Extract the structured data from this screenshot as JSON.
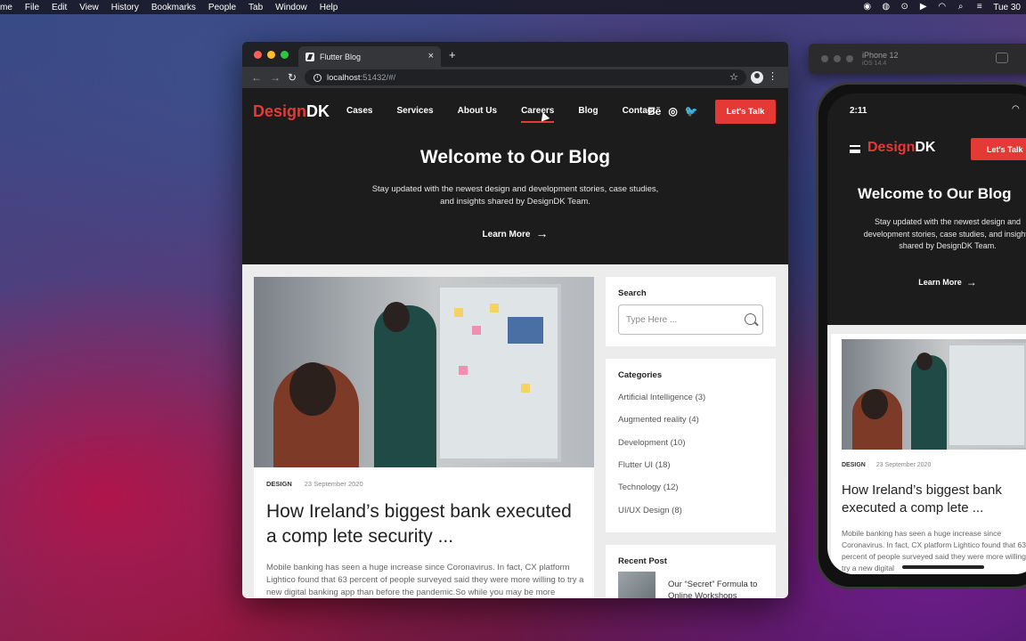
{
  "menubar": {
    "items": [
      "me",
      "File",
      "Edit",
      "View",
      "History",
      "Bookmarks",
      "People",
      "Tab",
      "Window",
      "Help"
    ],
    "clock": "Tue 30"
  },
  "browser": {
    "tab_title": "Flutter Blog",
    "url_host": "localhost",
    "url_rest": ":51432/#/"
  },
  "site": {
    "logo_red": "Design",
    "logo_white": "DK",
    "nav": [
      "Cases",
      "Services",
      "About Us",
      "Careers",
      "Blog",
      "Contact"
    ],
    "social": [
      "Bē",
      "◎",
      "🐦"
    ],
    "cta": "Let's Talk",
    "hero_title": "Welcome to Our Blog",
    "hero_sub_1": "Stay updated with the newest design and development stories, case studies,",
    "hero_sub_2": "and insights shared by DesignDK Team.",
    "learn_more": "Learn More",
    "post": {
      "category": "DESIGN",
      "date": "23 September 2020",
      "title": "How Ireland’s biggest bank executed a comp lete security ...",
      "excerpt": "Mobile banking has seen a huge increase since Coronavirus. In fact, CX platform Lightico found that 63 percent of people surveyed said they were more willing to try a new digital banking app than before the pandemic.So while you may be more inclined"
    },
    "sidebar": {
      "search_label": "Search",
      "search_placeholder": "Type Here ...",
      "categories_label": "Categories",
      "categories": [
        "Artificial Intelligence (3)",
        "Augmented reality (4)",
        "Development (10)",
        "Flutter UI (18)",
        "Technology (12)",
        "UI/UX Design (8)"
      ],
      "recent_label": "Recent Post",
      "recent_title": "Our “Secret” Formula to Online Workshops"
    }
  },
  "simulator": {
    "device": "iPhone 12",
    "os": "iOS 14.4"
  },
  "phone": {
    "time": "2:11",
    "logo_red": "Design",
    "logo_white": "DK",
    "cta": "Let's Talk",
    "hero_title": "Welcome to Our Blog",
    "hero_sub": "Stay updated with the newest design and development stories, case studies, and insights shared by DesignDK Team.",
    "learn_more": "Learn More",
    "post_category": "DESIGN",
    "post_date": "23 September 2020",
    "post_title": "How Ireland’s biggest bank executed a comp lete ...",
    "post_excerpt": "Mobile banking has seen a huge increase since Coronavirus. In fact, CX platform Lightico found that 63 percent of people surveyed said they were more willing to try a new digital"
  },
  "colors": {
    "brand_red": "#e53935",
    "hero_bg": "#1c1c1c"
  }
}
